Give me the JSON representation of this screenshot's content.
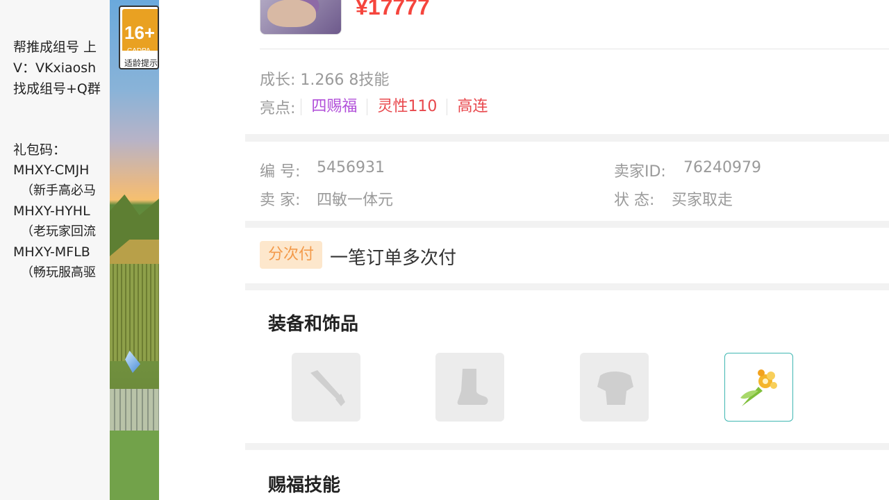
{
  "left_panel": {
    "lines": [
      "帮推成组号 上",
      "V：VKxiaosh",
      "找成组号+Q群",
      "礼包码：",
      "MHXY-CMJH",
      "（新手高必马",
      "MHXY-HYHL",
      "（老玩家回流",
      "MHXY-MFLB",
      "（畅玩服高驱"
    ]
  },
  "age_badge": {
    "number": "16+",
    "cadpa": "CADPA",
    "tip": "适龄提示"
  },
  "listing": {
    "price": "¥17777",
    "growth": "成长: 1.266  8技能",
    "highlights_label": "亮点:",
    "highlights": [
      {
        "text": "四赐福",
        "color": "#b14fd9"
      },
      {
        "text": "灵性110",
        "color": "#e8474c"
      },
      {
        "text": "高连",
        "color": "#e8474c"
      }
    ]
  },
  "info": {
    "id_label": "编 号:",
    "id_value": "5456931",
    "seller_id_label": "卖家ID:",
    "seller_id_value": "76240979",
    "seller_label": "卖 家:",
    "seller_value": "四敏一体元",
    "status_label": "状 态:",
    "status_value": "买家取走"
  },
  "payment": {
    "badge": "分次付",
    "text": "一笔订单多次付"
  },
  "equipment": {
    "title": "装备和饰品",
    "slots": [
      {
        "icon": "sword-icon",
        "filled": false
      },
      {
        "icon": "boot-icon",
        "filled": false
      },
      {
        "icon": "armor-icon",
        "filled": false
      },
      {
        "icon": "flower-accessory-icon",
        "filled": true
      }
    ]
  },
  "skills": {
    "title": "赐福技能"
  },
  "colors": {
    "price": "#f5453d",
    "accent_teal": "#3fb7b2",
    "badge_orange": "#f39a4a"
  }
}
